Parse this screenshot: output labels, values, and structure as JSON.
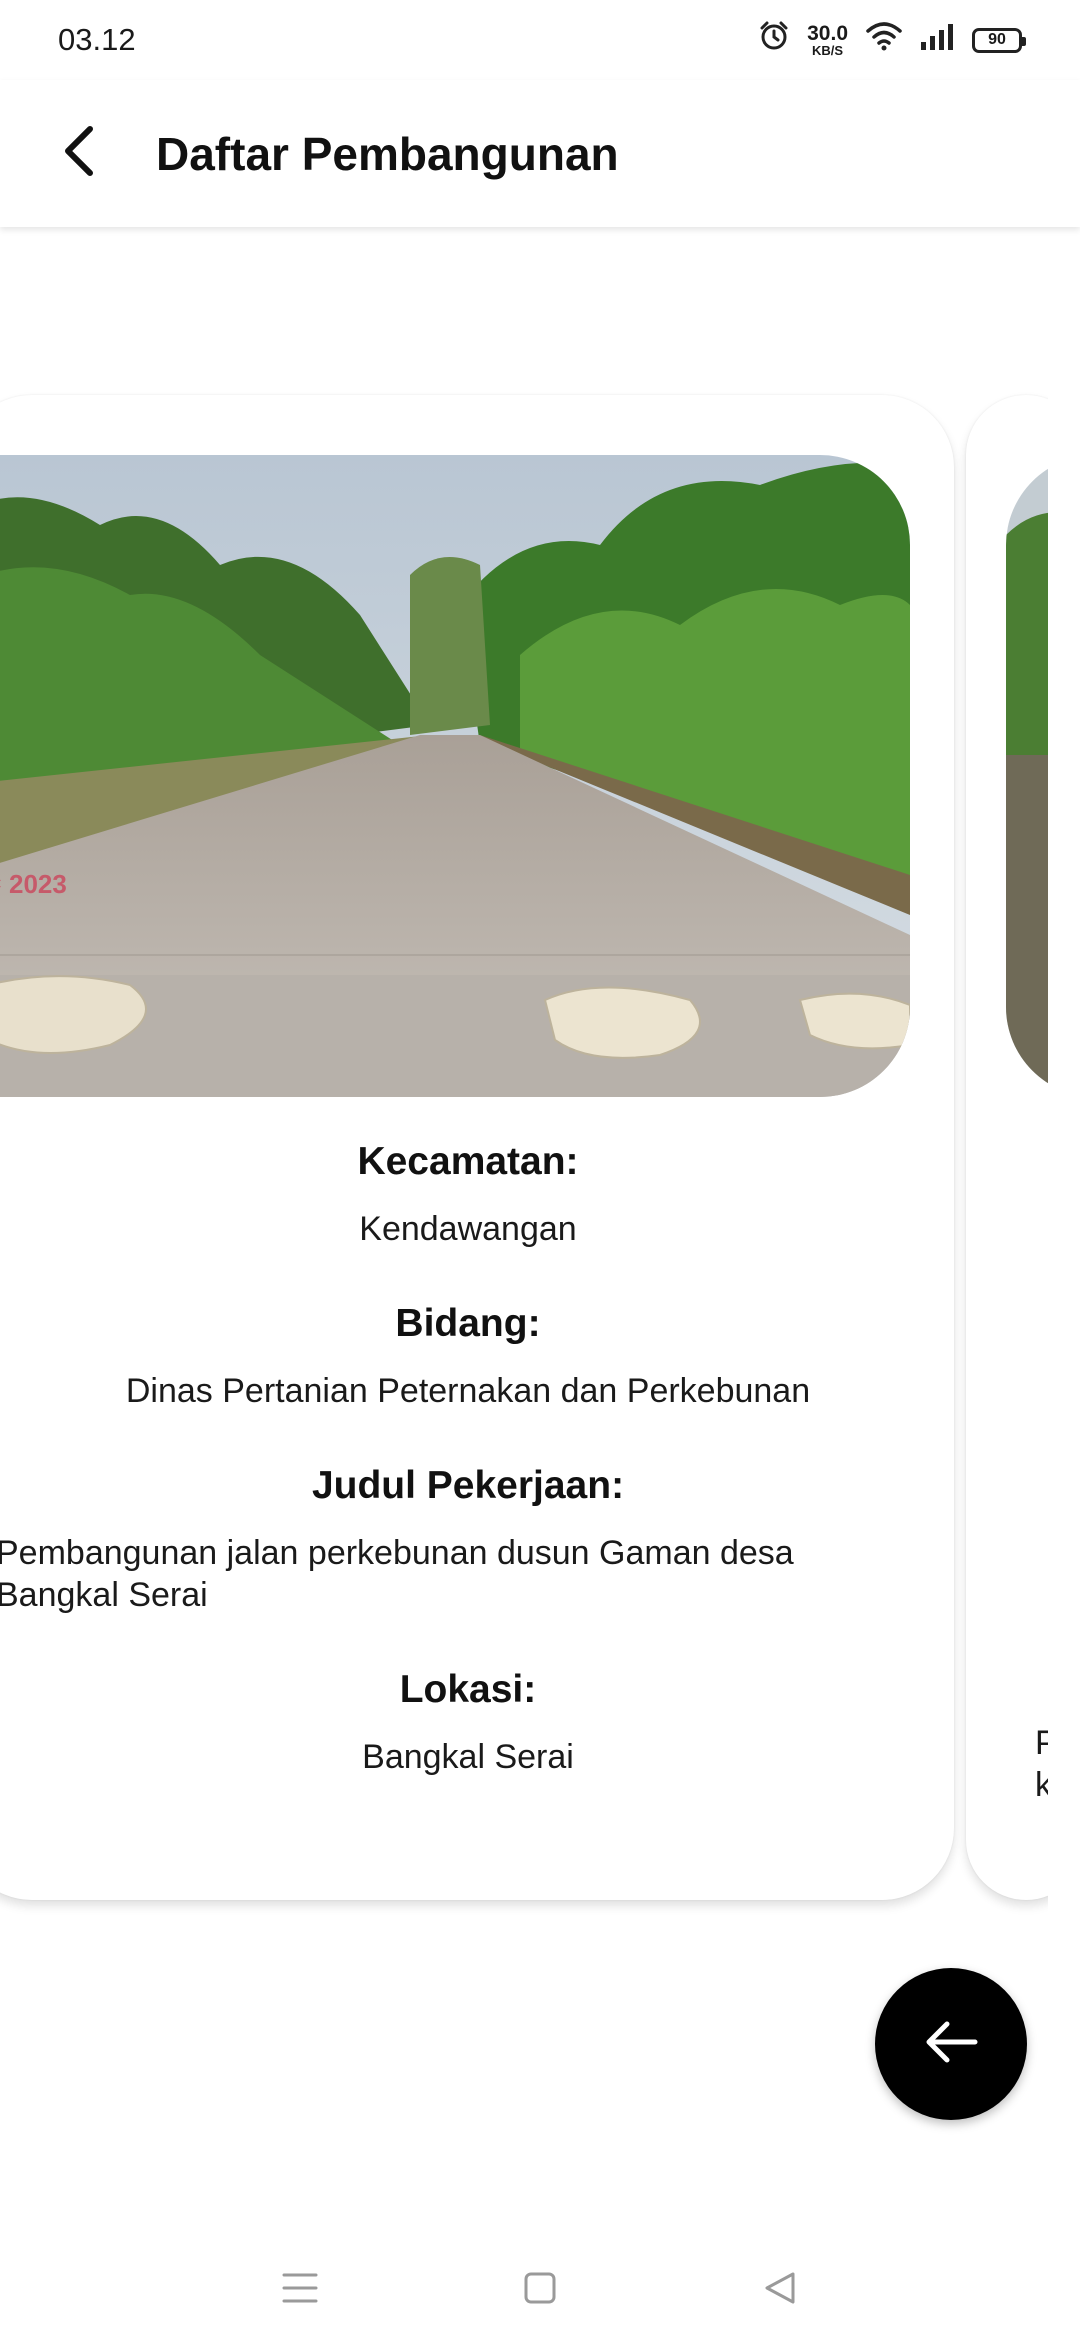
{
  "status": {
    "time": "03.12",
    "net_speed": "30.0",
    "net_unit": "KB/S",
    "battery": "90"
  },
  "header": {
    "title": "Daftar Pembangunan"
  },
  "card": {
    "kecamatan_label": "Kecamatan:",
    "kecamatan_value": "Kendawangan",
    "bidang_label": "Bidang:",
    "bidang_value": "Dinas Pertanian Peternakan dan Perkebunan",
    "judul_label": "Judul Pekerjaan:",
    "judul_value": "Pembangunan jalan perkebunan dusun Gaman desa Bangkal Serai",
    "lokasi_label": "Lokasi:",
    "lokasi_value": "Bangkal Serai"
  },
  "next_card": {
    "text_line1": "P",
    "text_line2": "k"
  },
  "icons": {
    "back": "arrow-left-icon",
    "fab": "arrow-left-icon",
    "nav_menu": "menu-icon",
    "nav_home": "square-icon",
    "nav_back": "triangle-back-icon"
  },
  "colors": {
    "fab_bg": "#000000",
    "card_bg": "#ffffff"
  }
}
